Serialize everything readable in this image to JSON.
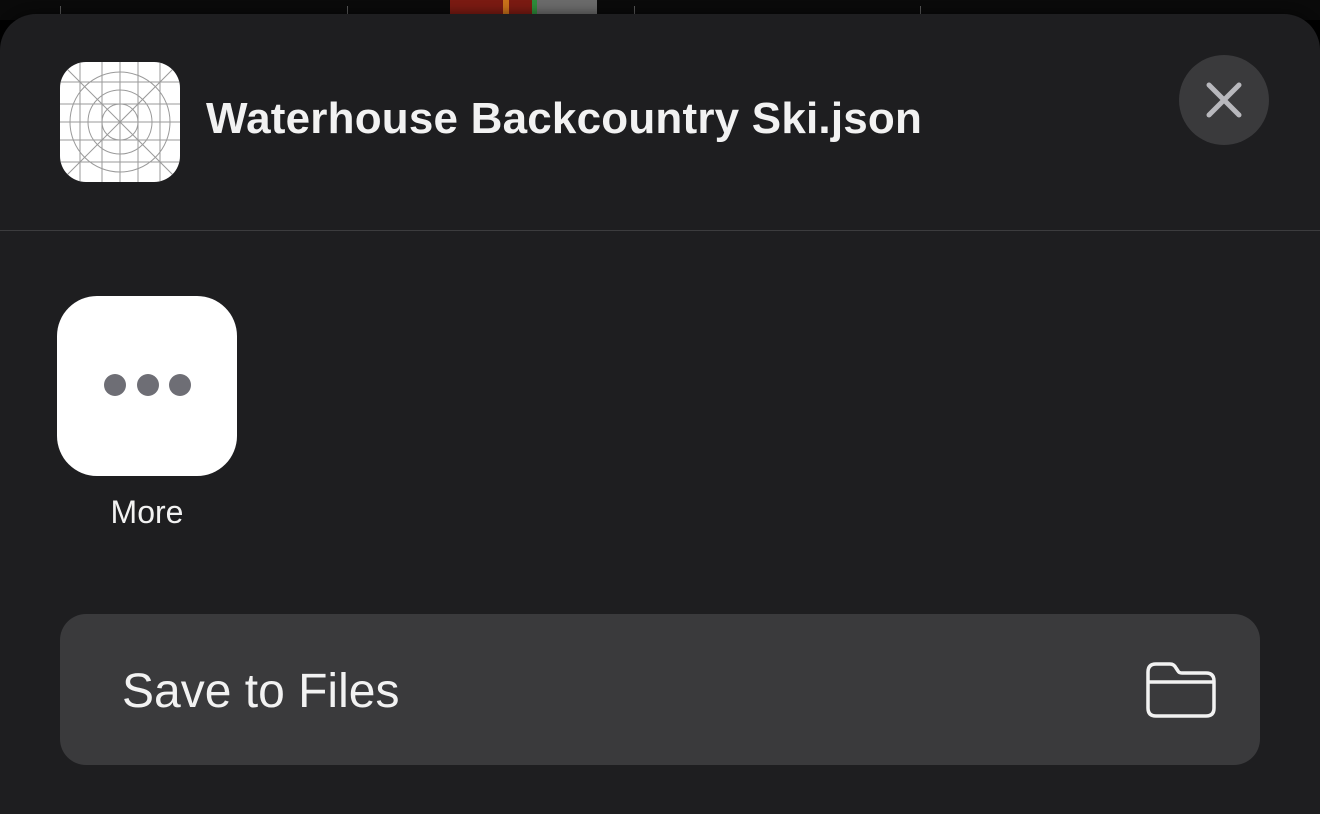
{
  "share_sheet": {
    "file_name": "Waterhouse Backcountry Ski.json",
    "close_label": "Close"
  },
  "apps": [
    {
      "label": "More",
      "icon": "ellipsis-icon"
    }
  ],
  "actions": [
    {
      "label": "Save to Files",
      "icon": "folder-icon"
    }
  ],
  "colors": {
    "sheet_background": "#1e1e20",
    "row_background": "#3a3a3c",
    "text": "#f2f2f2"
  }
}
